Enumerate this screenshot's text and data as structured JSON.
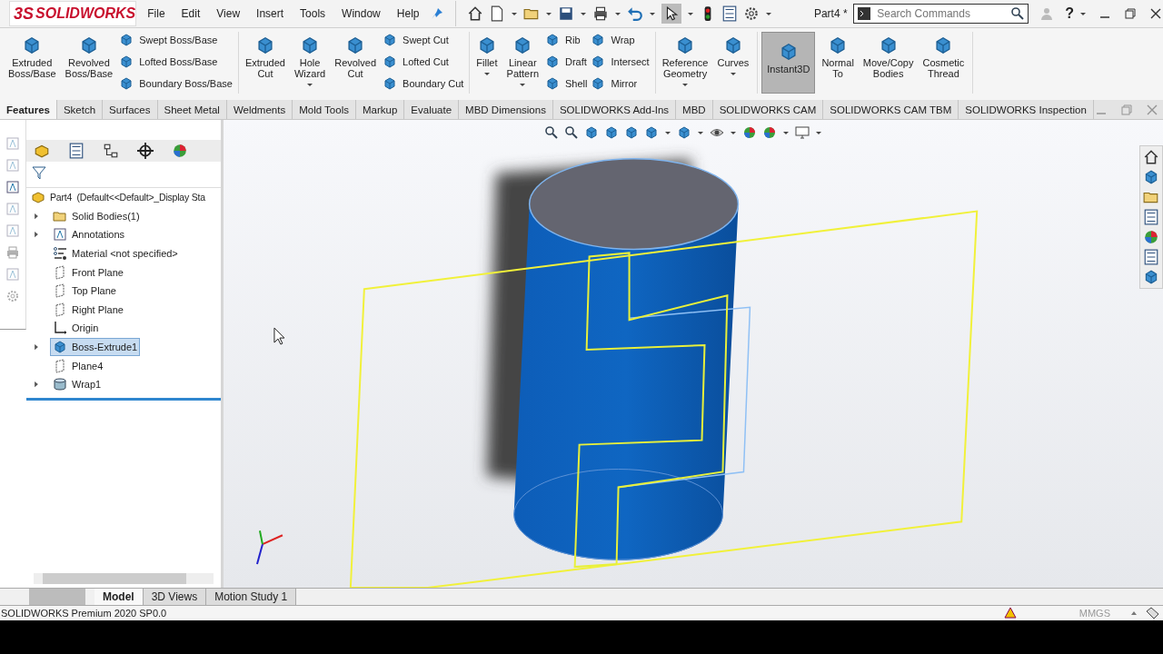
{
  "app": {
    "logo_prefix": "3S",
    "logo": "SOLIDWORKS"
  },
  "menu": [
    "File",
    "Edit",
    "View",
    "Insert",
    "Tools",
    "Window",
    "Help"
  ],
  "document_title": "Part4 *",
  "search": {
    "placeholder": "Search Commands"
  },
  "help_glyph": "?",
  "ribbon": [
    {
      "items": [
        {
          "kind": "large",
          "label": "Extruded\nBoss/Base",
          "dropdown": false,
          "active": false
        },
        {
          "kind": "large",
          "label": "Revolved\nBoss/Base",
          "dropdown": false,
          "active": false
        },
        {
          "kind": "stack",
          "labels": [
            "Swept Boss/Base",
            "Lofted Boss/Base",
            "Boundary Boss/Base"
          ]
        }
      ]
    },
    {
      "items": [
        {
          "kind": "large",
          "label": "Extruded\nCut",
          "dropdown": false,
          "active": false
        },
        {
          "kind": "large",
          "label": "Hole\nWizard",
          "dropdown": true,
          "active": false
        },
        {
          "kind": "large",
          "label": "Revolved\nCut",
          "dropdown": false,
          "active": false
        },
        {
          "kind": "stack",
          "labels": [
            "Swept Cut",
            "Lofted Cut",
            "Boundary Cut"
          ]
        }
      ]
    },
    {
      "items": [
        {
          "kind": "large",
          "label": "Fillet",
          "dropdown": true,
          "active": false
        },
        {
          "kind": "large",
          "label": "Linear\nPattern",
          "dropdown": true,
          "active": false
        },
        {
          "kind": "stack",
          "labels": [
            "Rib",
            "Draft",
            "Shell"
          ]
        },
        {
          "kind": "stack",
          "labels": [
            "Wrap",
            "Intersect",
            "Mirror"
          ]
        }
      ]
    },
    {
      "items": [
        {
          "kind": "large",
          "label": "Reference\nGeometry",
          "dropdown": true,
          "active": false
        },
        {
          "kind": "large",
          "label": "Curves",
          "dropdown": true,
          "active": false
        }
      ]
    },
    {
      "items": [
        {
          "kind": "large",
          "label": "Instant3D",
          "dropdown": false,
          "active": true
        },
        {
          "kind": "large",
          "label": "Normal\nTo",
          "dropdown": false,
          "active": false
        },
        {
          "kind": "large",
          "label": "Move/Copy\nBodies",
          "dropdown": false,
          "active": false
        },
        {
          "kind": "large",
          "label": "Cosmetic\nThread",
          "dropdown": false,
          "active": false
        }
      ]
    }
  ],
  "command_tabs": [
    {
      "label": "Features",
      "selected": true
    },
    {
      "label": "Sketch",
      "selected": false
    },
    {
      "label": "Surfaces",
      "selected": false
    },
    {
      "label": "Sheet Metal",
      "selected": false
    },
    {
      "label": "Weldments",
      "selected": false
    },
    {
      "label": "Mold Tools",
      "selected": false
    },
    {
      "label": "Markup",
      "selected": false
    },
    {
      "label": "Evaluate",
      "selected": false
    },
    {
      "label": "MBD Dimensions",
      "selected": false
    },
    {
      "label": "SOLIDWORKS Add-Ins",
      "selected": false
    },
    {
      "label": "MBD",
      "selected": false
    },
    {
      "label": "SOLIDWORKS CAM",
      "selected": false
    },
    {
      "label": "SOLIDWORKS CAM TBM",
      "selected": false
    },
    {
      "label": "SOLIDWORKS Inspection",
      "selected": false
    }
  ],
  "feature_tree": {
    "root": "Part4  (Default<<Default>_Display Sta",
    "items": [
      {
        "kind": "folder",
        "label": "Solid Bodies(1)",
        "expandable": true,
        "selected": false
      },
      {
        "kind": "annotations",
        "label": "Annotations",
        "expandable": true,
        "selected": false
      },
      {
        "kind": "material",
        "label": "Material <not specified>",
        "expandable": false,
        "selected": false
      },
      {
        "kind": "plane",
        "label": "Front Plane",
        "expandable": false,
        "selected": false
      },
      {
        "kind": "plane",
        "label": "Top Plane",
        "expandable": false,
        "selected": false
      },
      {
        "kind": "plane",
        "label": "Right Plane",
        "expandable": false,
        "selected": false
      },
      {
        "kind": "origin",
        "label": "Origin",
        "expandable": false,
        "selected": false
      },
      {
        "kind": "feature",
        "label": "Boss-Extrude1",
        "expandable": true,
        "selected": true
      },
      {
        "kind": "plane",
        "label": "Plane4",
        "expandable": false,
        "selected": false
      },
      {
        "kind": "wrap",
        "label": "Wrap1",
        "expandable": true,
        "selected": false
      }
    ]
  },
  "bottom_tabs": [
    {
      "label": "Model",
      "selected": true
    },
    {
      "label": "3D Views",
      "selected": false
    },
    {
      "label": "Motion Study 1",
      "selected": false
    }
  ],
  "status_bar": {
    "text": "SOLIDWORKS Premium 2020 SP0.0",
    "units": "MMGS"
  }
}
